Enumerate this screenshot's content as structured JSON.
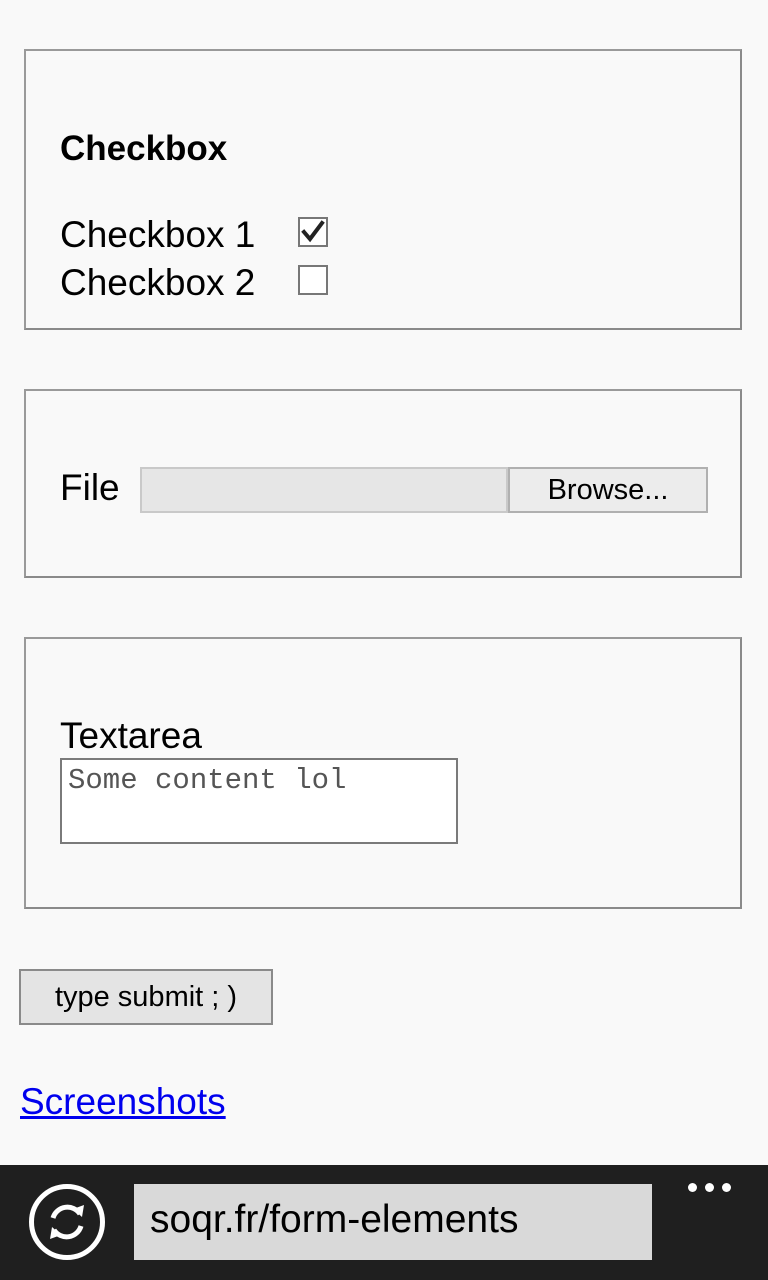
{
  "checkbox_section": {
    "title": "Checkbox",
    "items": [
      {
        "label": "Checkbox 1",
        "checked": true
      },
      {
        "label": "Checkbox 2",
        "checked": false
      }
    ]
  },
  "file_section": {
    "label": "File",
    "browse_label": "Browse..."
  },
  "textarea_section": {
    "label": "Textarea",
    "value": "Some content lol"
  },
  "submit": {
    "label": "type submit ; )"
  },
  "link": {
    "label": "Screenshots"
  },
  "browser": {
    "address": "soqr.fr/form-elements",
    "refresh_icon": "refresh-icon",
    "more_icon": "more-icon"
  },
  "colors": {
    "link": "#0000ee",
    "appbar": "#1f1f1f",
    "page_background": "#f9f9f9"
  }
}
